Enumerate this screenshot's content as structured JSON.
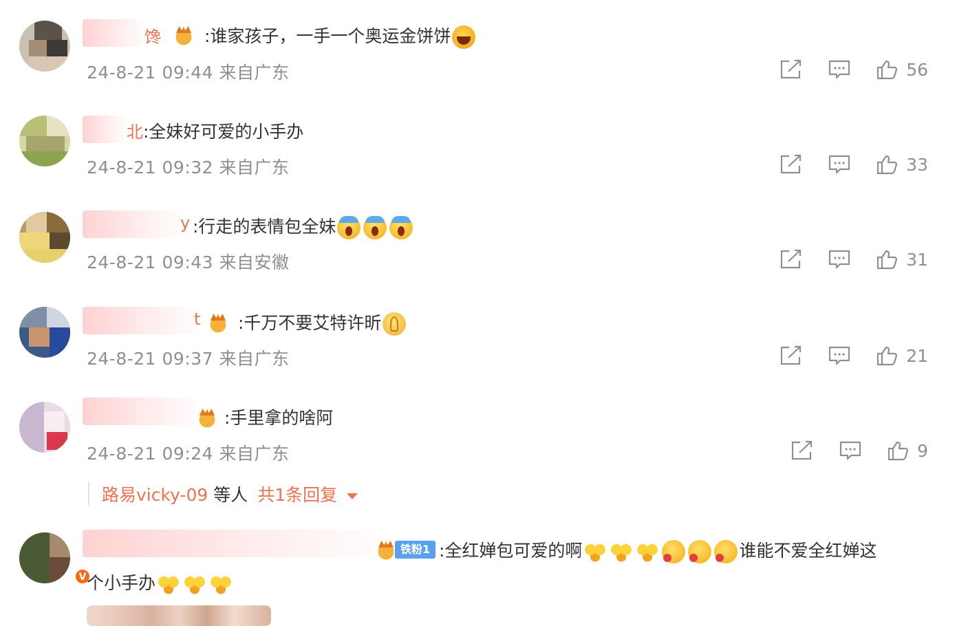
{
  "colors": {
    "accent": "#eb7350",
    "meta": "#8f8f8f",
    "text": "#333333",
    "fan_badge": "#5aa0f0",
    "v_badge": "#f86a15"
  },
  "icons": {
    "share": "share-icon",
    "comment": "comment-icon",
    "like": "thumbs-up-icon"
  },
  "comments": [
    {
      "name_tail": "馋",
      "text": ":谁家孩子，一手一个奥运金饼饼",
      "time": "24-8-21 09:44",
      "source": "来自广东",
      "likes": "56"
    },
    {
      "name_tail": "北",
      "text": ":全妹好可爱的小手办",
      "time": "24-8-21 09:32",
      "source": "来自广东",
      "likes": "33"
    },
    {
      "name_tail": "y",
      "text": ":行走的表情包全妹",
      "time": "24-8-21 09:43",
      "source": "来自安徽",
      "likes": "31"
    },
    {
      "name_tail": "t",
      "text": ":千万不要艾特许昕",
      "time": "24-8-21 09:37",
      "source": "来自广东",
      "likes": "21"
    },
    {
      "name_tail": "",
      "text": ":手里拿的啥阿",
      "time": "24-8-21 09:24",
      "source": "来自广东",
      "likes": "9"
    }
  ],
  "replies": {
    "name": "路易vicky-09",
    "mid": "等人",
    "total": "共1条回复"
  },
  "last_comment": {
    "fan_badge": "铁粉1",
    "text_line1": ":全红婵包可爱的啊",
    "text_after_emoji": "谁能不爱全红婵这",
    "text_line2": "个小手办",
    "v_badge": "V"
  }
}
